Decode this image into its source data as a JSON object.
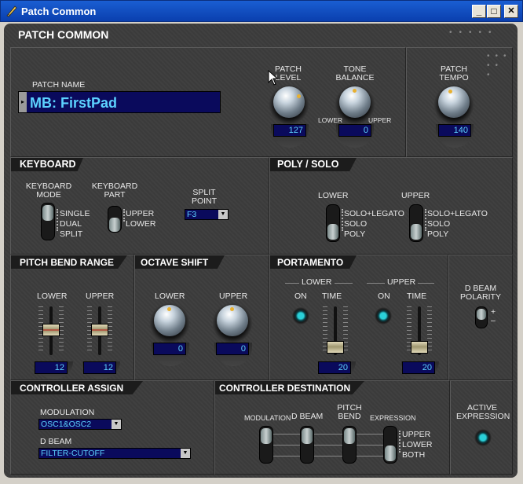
{
  "window": {
    "title": "Patch Common",
    "minimize": "_",
    "maximize": "□",
    "close": "✕"
  },
  "main": {
    "title": "PATCH COMMON"
  },
  "patch": {
    "name_label": "PATCH NAME",
    "name_value": "MB: FirstPad",
    "level_label_1": "PATCH",
    "level_label_2": "LEVEL",
    "level_value": "127",
    "balance_label_1": "TONE",
    "balance_label_2": "BALANCE",
    "balance_lower": "LOWER",
    "balance_upper": "UPPER",
    "balance_value": "0",
    "tempo_label_1": "PATCH",
    "tempo_label_2": "TEMPO",
    "tempo_value": "140"
  },
  "keyboard": {
    "title": "KEYBOARD",
    "mode_label_1": "KEYBOARD",
    "mode_label_2": "MODE",
    "mode_options": [
      "SINGLE",
      "DUAL",
      "SPLIT"
    ],
    "part_label_1": "KEYBOARD",
    "part_label_2": "PART",
    "part_options": [
      "UPPER",
      "LOWER"
    ],
    "split_label_1": "SPLIT",
    "split_label_2": "POINT",
    "split_value": "F3"
  },
  "poly_solo": {
    "title": "POLY / SOLO",
    "lower_label": "LOWER",
    "upper_label": "UPPER",
    "options": [
      "SOLO+LEGATO",
      "SOLO",
      "POLY"
    ]
  },
  "pitch_bend": {
    "title": "PITCH BEND RANGE",
    "lower_label": "LOWER",
    "upper_label": "UPPER",
    "lower_value": "12",
    "upper_value": "12"
  },
  "octave": {
    "title": "OCTAVE SHIFT",
    "lower_label": "LOWER",
    "upper_label": "UPPER",
    "lower_value": "0",
    "upper_value": "0"
  },
  "portamento": {
    "title": "PORTAMENTO",
    "lower_group": "LOWER",
    "upper_group": "UPPER",
    "on_label": "ON",
    "time_label": "TIME",
    "lower_time": "20",
    "upper_time": "20"
  },
  "dbeam_polarity": {
    "label_1": "D BEAM",
    "label_2": "POLARITY",
    "plus": "+",
    "minus": "–"
  },
  "controller_assign": {
    "title": "CONTROLLER ASSIGN",
    "modulation_label": "MODULATION",
    "modulation_value": "OSC1&OSC2",
    "dbeam_label": "D BEAM",
    "dbeam_value": "FILTER-CUTOFF"
  },
  "controller_destination": {
    "title": "CONTROLLER DESTINATION",
    "col_modulation": "MODULATION",
    "col_dbeam": "D BEAM",
    "col_pitch_1": "PITCH",
    "col_pitch_2": "BEND",
    "col_expression": "EXPRESSION",
    "options": [
      "UPPER",
      "LOWER",
      "BOTH"
    ]
  },
  "active_expression": {
    "label_1": "ACTIVE",
    "label_2": "EXPRESSION"
  },
  "colors": {
    "lcd_bg": "#0a0a5c",
    "lcd_text": "#5cd2ff",
    "panel_bg": "#3c3c3c",
    "title_bar": "#1a5ed2"
  }
}
